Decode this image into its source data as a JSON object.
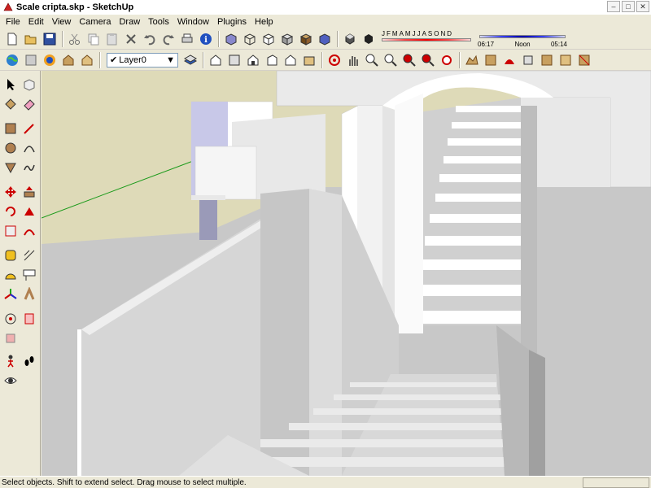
{
  "window": {
    "title": "Scale cripta.skp - SketchUp"
  },
  "menu": {
    "items": [
      "File",
      "Edit",
      "View",
      "Camera",
      "Draw",
      "Tools",
      "Window",
      "Plugins",
      "Help"
    ]
  },
  "layers": {
    "current": "Layer0"
  },
  "shadows": {
    "months": [
      "J",
      "F",
      "M",
      "A",
      "M",
      "J",
      "J",
      "A",
      "S",
      "O",
      "N",
      "D"
    ],
    "time_start": "06:17",
    "time_mid": "Noon",
    "time_end": "05:14"
  },
  "status": {
    "text": "Select objects. Shift to extend select. Drag mouse to select multiple."
  },
  "colors": {
    "ground": "#DEDAB8",
    "wall": "#D4D4D4",
    "wall_light": "#FFFFFF",
    "accent_blue": "#2050C0"
  }
}
